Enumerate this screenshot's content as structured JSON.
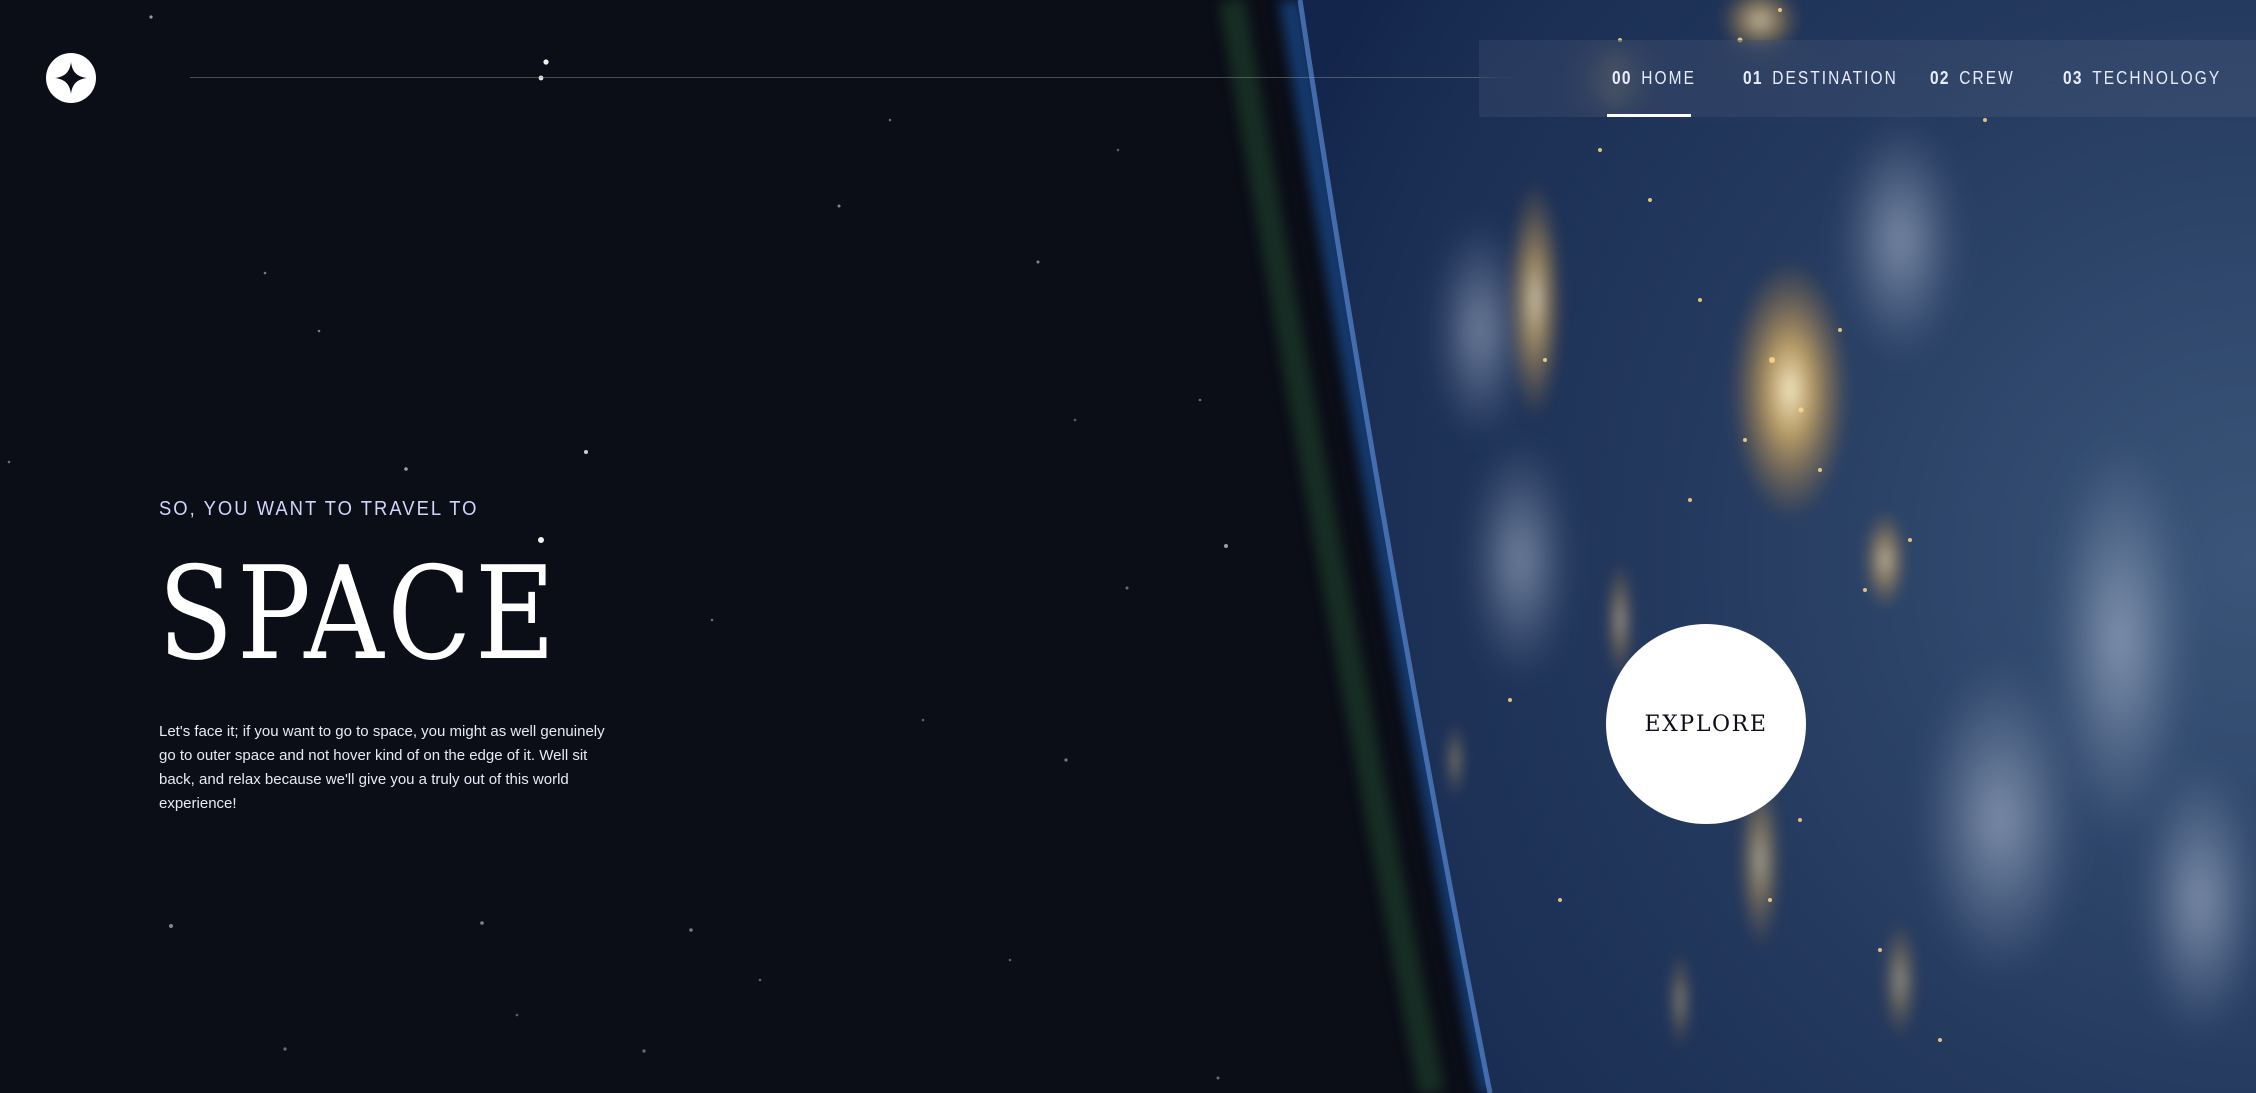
{
  "colors": {
    "background": "#0b0d17",
    "accent_text": "#d0d6f9",
    "white": "#ffffff"
  },
  "header": {
    "logo_icon": "star-compass-icon",
    "nav": [
      {
        "num": "00",
        "label": "HOME",
        "active": true
      },
      {
        "num": "01",
        "label": "DESTINATION",
        "active": false
      },
      {
        "num": "02",
        "label": "CREW",
        "active": false
      },
      {
        "num": "03",
        "label": "TECHNOLOGY",
        "active": false
      }
    ]
  },
  "hero": {
    "eyebrow": "SO, YOU WANT TO TRAVEL TO",
    "title": "SPACE",
    "body": "Let's face it; if you want to go to space, you might as well genuinely go to outer space and not hover kind of on the edge of it. Well sit back, and relax because we'll give you a truly out of this world experience!",
    "explore_label": "EXPLORE"
  }
}
